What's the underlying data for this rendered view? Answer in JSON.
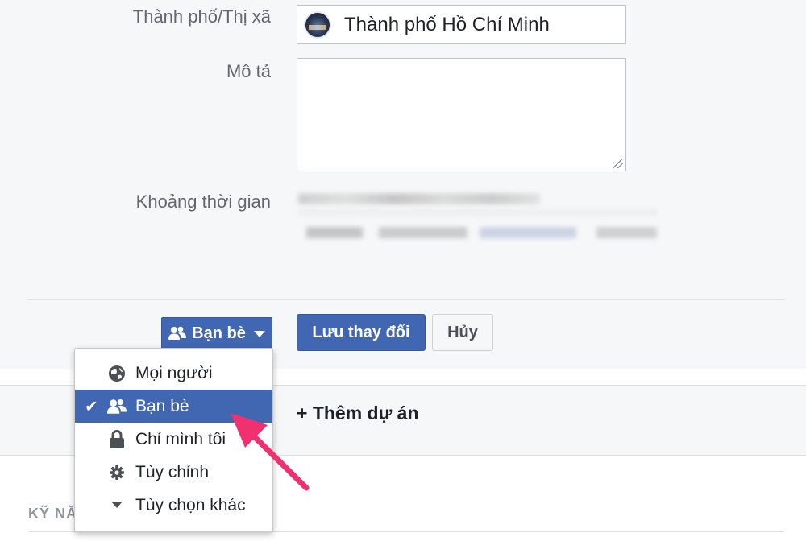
{
  "form": {
    "city_label": "Thành phố/Thị xã",
    "city_value": "Thành phố Hồ Chí Minh",
    "description_label": "Mô tả",
    "description_value": "",
    "time_period_label": "Khoảng thời gian"
  },
  "actions": {
    "privacy_label": "Bạn bè",
    "save_label": "Lưu thay đổi",
    "cancel_label": "Hủy"
  },
  "projects": {
    "add_label": "+ Thêm dự án"
  },
  "skills": {
    "header": "KỸ NĂ"
  },
  "privacy_menu": {
    "items": [
      {
        "label": "Mọi người",
        "icon": "globe-icon",
        "selected": false
      },
      {
        "label": "Bạn bè",
        "icon": "friends-icon",
        "selected": true
      },
      {
        "label": "Chỉ mình tôi",
        "icon": "lock-icon",
        "selected": false
      },
      {
        "label": "Tùy chỉnh",
        "icon": "gear-icon",
        "selected": false
      },
      {
        "label": "Tùy chọn khác",
        "icon": "caret-down-icon",
        "selected": false
      }
    ]
  },
  "colors": {
    "primary": "#4267b2",
    "annotation_arrow": "#f0306f",
    "panel_background": "#f6f7f9"
  }
}
